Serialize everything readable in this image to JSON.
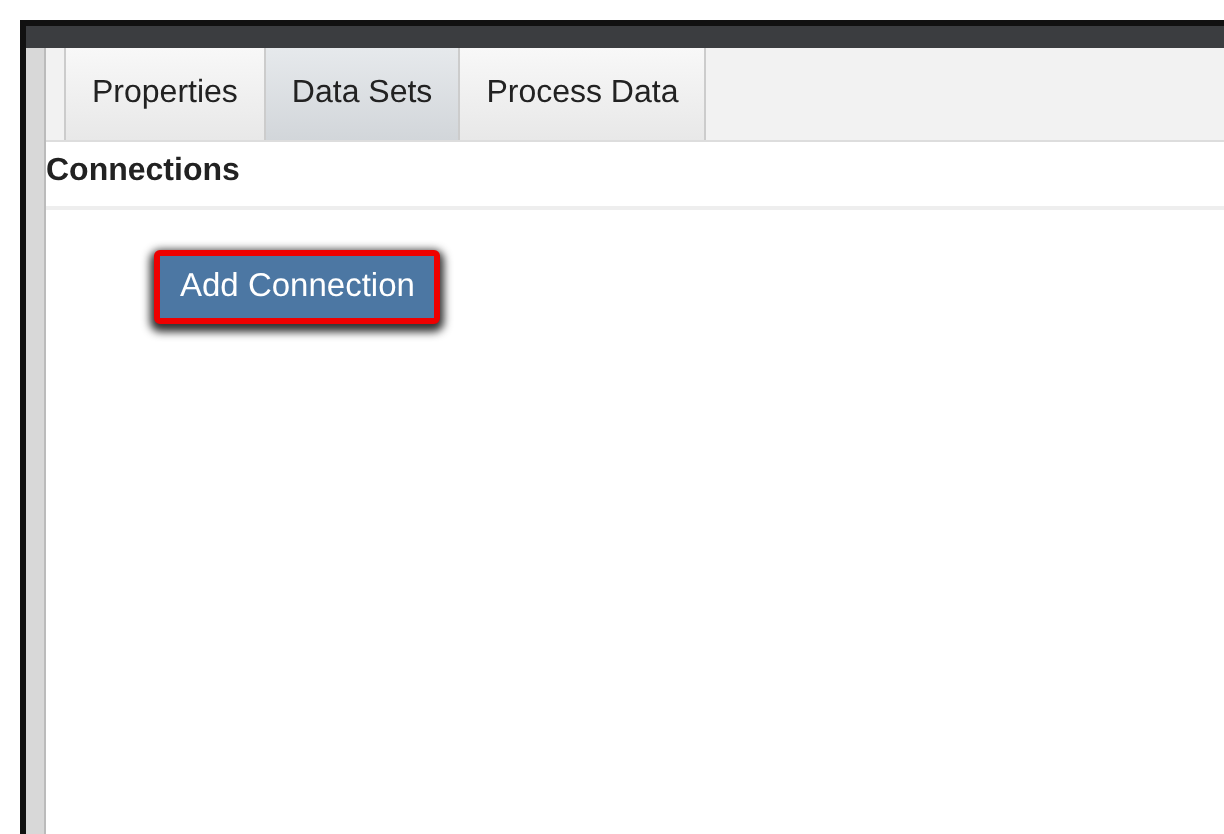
{
  "tabs": [
    {
      "label": "Properties",
      "selected": false
    },
    {
      "label": "Data Sets",
      "selected": true
    },
    {
      "label": "Process Data",
      "selected": false
    }
  ],
  "section": {
    "title": "Connections"
  },
  "add_button": {
    "label": "Add Connection",
    "highlighted": true
  }
}
